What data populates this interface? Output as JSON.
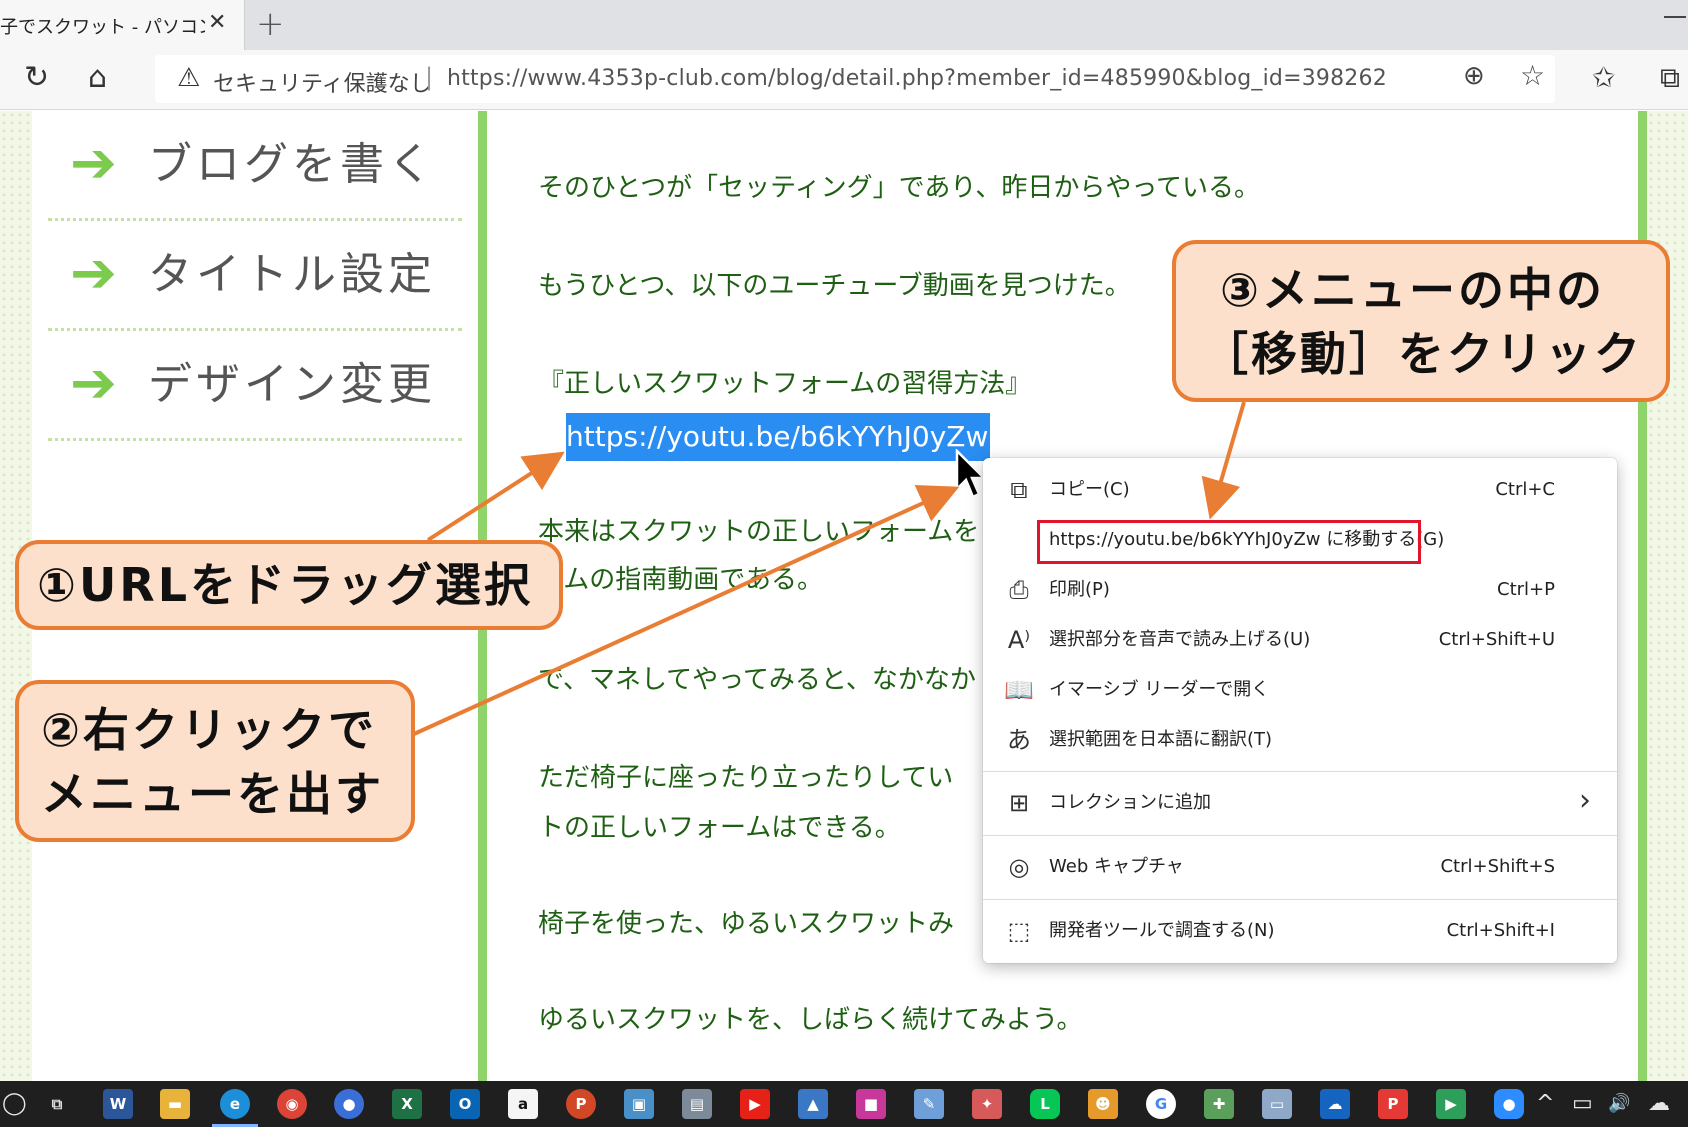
{
  "browser": {
    "tab_title": "子でスクワット - パソコン市民",
    "tab_close": "✕",
    "new_tab": "+",
    "security_label": "セキュリティ保護なし",
    "address_separator": "|",
    "url": "https://www.4353p-club.com/blog/detail.php?member_id=485990&blog_id=398262"
  },
  "sidebar": {
    "items": [
      {
        "arrow": "➔",
        "label": "ブログを書く"
      },
      {
        "arrow": "➔",
        "label": "タイトル設定"
      },
      {
        "arrow": "➔",
        "label": "デザイン変更"
      }
    ]
  },
  "article": {
    "paragraphs": [
      "そのひとつが「セッティング」であり、昨日からやっている。",
      "もうひとつ、以下のユーチューブ動画を見つけた。",
      "『正しいスクワットフォームの習得方法』",
      "本来はスクワットの正しいフォームを",
      "ームの指南動画である。",
      "で、マネしてやってみると、なかなか",
      "ただ椅子に座ったり立ったりしてい",
      "トの正しいフォームはできる。",
      "椅子を使った、ゆるいスクワットみ",
      "ゆるいスクワットを、しばらく続けてみよう。"
    ],
    "selected_url": "https://youtu.be/b6kYYhJ0yZw"
  },
  "context_menu": {
    "items": [
      {
        "icon": "copy-icon",
        "glyph": "⧉",
        "label": "コピー(C)",
        "shortcut": "Ctrl+C"
      },
      {
        "icon": "none",
        "glyph": "",
        "label": "https://youtu.be/b6kYYhJ0yZw に移動する(G)",
        "shortcut": ""
      },
      {
        "icon": "print-icon",
        "glyph": "⎙",
        "label": "印刷(P)",
        "shortcut": "Ctrl+P"
      },
      {
        "icon": "read-aloud-icon",
        "glyph": "A⁾",
        "label": "選択部分を音声で読み上げる(U)",
        "shortcut": "Ctrl+Shift+U"
      },
      {
        "icon": "immersive-reader-icon",
        "glyph": "📖",
        "label": "イマーシブ リーダーで開く",
        "shortcut": ""
      },
      {
        "icon": "translate-icon",
        "glyph": "あ",
        "label": "選択範囲を日本語に翻訳(T)",
        "shortcut": ""
      },
      {
        "icon": "collections-icon",
        "glyph": "⊞",
        "label": "コレクションに追加",
        "shortcut": "",
        "submenu": "›"
      },
      {
        "icon": "web-capture-icon",
        "glyph": "◎",
        "label": "Web キャプチャ",
        "shortcut": "Ctrl+Shift+S"
      },
      {
        "icon": "devtools-icon",
        "glyph": "⬚",
        "label": "開発者ツールで調査する(N)",
        "shortcut": "Ctrl+Shift+I"
      }
    ]
  },
  "callouts": {
    "step1": "①URLをドラッグ選択",
    "step2_line1": "②右クリックで",
    "step2_line2": "メニューを出す",
    "step3_line1": "③メニューの中の",
    "step3_line2": "［移動］をクリック"
  },
  "colors": {
    "accent_orange": "#ea7d34",
    "callout_fill": "#fce0cb",
    "highlight_blue": "#2a8df2",
    "article_green": "#1f5f14",
    "border_green": "#8ed46a",
    "goto_box_red": "#e0142a"
  },
  "taskbar": {
    "apps": [
      {
        "name": "task-view-icon",
        "glyph": "⧉"
      },
      {
        "name": "word-icon",
        "glyph": "W"
      },
      {
        "name": "file-explorer-icon",
        "glyph": "▬"
      },
      {
        "name": "edge-icon",
        "glyph": "e"
      },
      {
        "name": "chrome-icon",
        "glyph": "◉"
      },
      {
        "name": "people-icon",
        "glyph": "●"
      },
      {
        "name": "excel-icon",
        "glyph": "X"
      },
      {
        "name": "outlook-icon",
        "glyph": "O"
      },
      {
        "name": "amazon-icon",
        "glyph": "a"
      },
      {
        "name": "powerpoint-icon",
        "glyph": "P"
      },
      {
        "name": "app-icon-1",
        "glyph": "▣"
      },
      {
        "name": "app-icon-2",
        "glyph": "▤"
      },
      {
        "name": "youtube-icon",
        "glyph": "▶"
      },
      {
        "name": "photos-icon",
        "glyph": "▲"
      },
      {
        "name": "paint-icon",
        "glyph": "■"
      },
      {
        "name": "paint3d-icon",
        "glyph": "✎"
      },
      {
        "name": "app-icon-3",
        "glyph": "✦"
      },
      {
        "name": "line-icon",
        "glyph": "L"
      },
      {
        "name": "app-icon-4",
        "glyph": "☻"
      },
      {
        "name": "google-icon",
        "glyph": "G"
      },
      {
        "name": "app-icon-5",
        "glyph": "✚"
      },
      {
        "name": "app-icon-6",
        "glyph": "▭"
      },
      {
        "name": "onedrive-icon",
        "glyph": "☁"
      },
      {
        "name": "pdf-png-icon",
        "glyph": "P"
      },
      {
        "name": "play-store-icon",
        "glyph": "▶"
      },
      {
        "name": "zoom-icon",
        "glyph": "●"
      }
    ],
    "tray": {
      "chevron": "^",
      "battery": "▭",
      "volume": "🔊",
      "cloud": "☁"
    }
  }
}
